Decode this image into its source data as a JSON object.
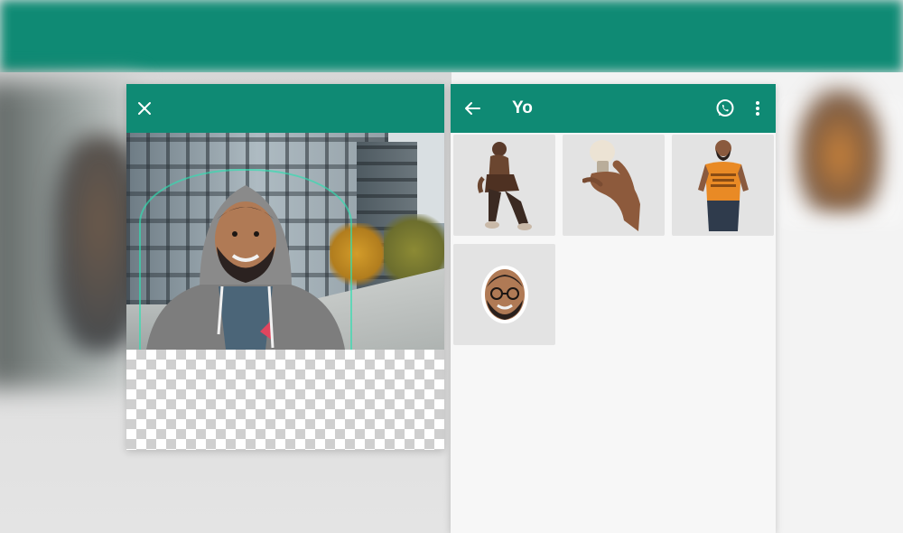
{
  "editor": {
    "close_icon": "close-icon",
    "image_description_icon": "person-cutout"
  },
  "pack": {
    "back_icon": "arrow-back-icon",
    "title": "Yo",
    "whatsapp_icon": "whatsapp-icon",
    "menu_icon": "more-vert-icon",
    "stickers": [
      {
        "icon": "sticker-man-sitting"
      },
      {
        "icon": "sticker-hand-lightbulb"
      },
      {
        "icon": "sticker-man-orange-shirt"
      },
      {
        "icon": "sticker-face"
      }
    ]
  },
  "colors": {
    "appbar": "#0f8a74",
    "outline": "#2fe0b2",
    "tile": "#e3e3e3"
  }
}
